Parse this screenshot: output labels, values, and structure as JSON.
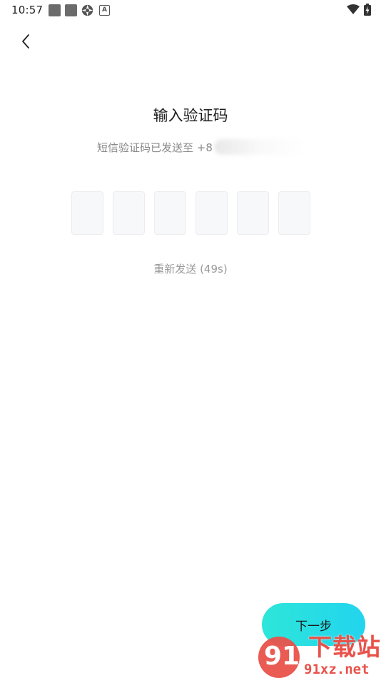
{
  "status_bar": {
    "time": "10:57",
    "a_icon_letter": "A"
  },
  "header": {
    "back_icon": "chevron-left-icon"
  },
  "main": {
    "title": "输入验证码",
    "subtitle_prefix": "短信验证码已发送至 +8",
    "code_boxes": [
      "",
      "",
      "",
      "",
      "",
      ""
    ],
    "resend_text": "重新发送 (49s)"
  },
  "footer": {
    "next_label": "下一步"
  },
  "watermark": {
    "number": "91",
    "text": "下载站",
    "url": "91xz.net"
  },
  "colors": {
    "accent_start": "#2ee6d9",
    "accent_end": "#22d4ee",
    "watermark": "#e8524a"
  }
}
